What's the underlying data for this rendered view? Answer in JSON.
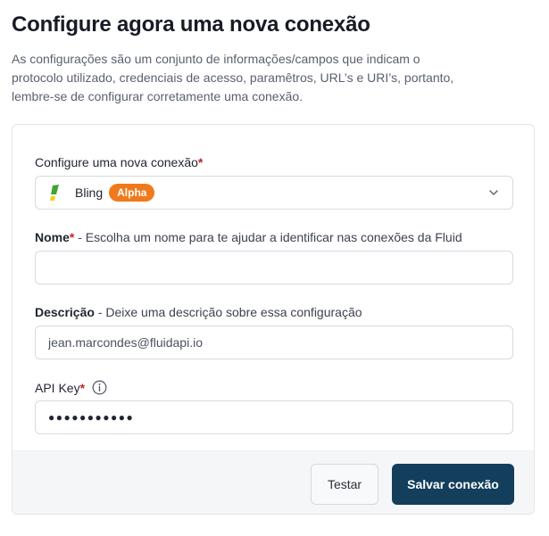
{
  "page": {
    "title": "Configure agora uma nova conexão",
    "subtitle": "As configurações são um conjunto de informações/campos que indicam o protocolo utilizado, credenciais de acesso, paramêtros, URL’s e URI’s, portanto, lembre-se de configurar corretamente uma conexão."
  },
  "form": {
    "connection": {
      "label": "Configure uma nova conexão",
      "required_mark": "*",
      "selected_value": "Bling",
      "badge": "Alpha",
      "logo_icon": "bling-logo-icon",
      "chevron_icon": "chevron-down-icon"
    },
    "name": {
      "label": "Nome",
      "required_mark": "*",
      "hint": " - Escolha um nome para te ajudar a identificar nas conexões da Fluid",
      "value": ""
    },
    "description": {
      "label": "Descrição",
      "hint": " - Deixe uma descrição sobre essa configuração",
      "value": "jean.marcondes@fluidapi.io"
    },
    "api_key": {
      "label": "API Key",
      "required_mark": "*",
      "info_icon": "info-icon",
      "masked_value": "●●●●●●●●●●●"
    }
  },
  "actions": {
    "test_label": "Testar",
    "save_label": "Salvar conexão"
  },
  "colors": {
    "primary": "#133f5c",
    "badge": "#f07a1b",
    "required": "#c0242b",
    "bling_green": "#3fa535",
    "bling_yellow": "#f2cf1d"
  }
}
